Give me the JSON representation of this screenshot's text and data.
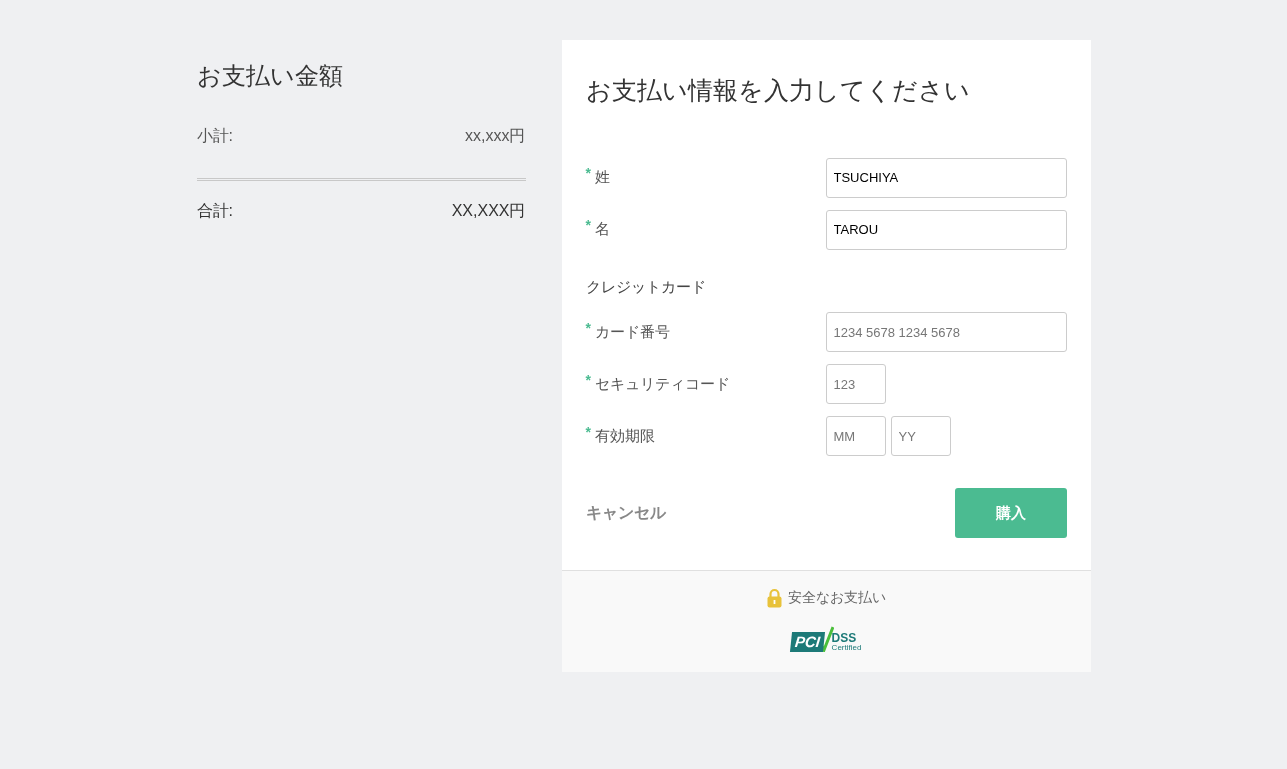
{
  "summary": {
    "title": "お支払い金額",
    "subtotal": {
      "label": "小計:",
      "value": "xx,xxx円"
    },
    "total": {
      "label": "合計:",
      "value": "XX,XXX円"
    }
  },
  "form": {
    "title": "お支払い情報を入力してください",
    "name_fields": [
      {
        "required_mark": "*",
        "label": "姓",
        "inputs": [
          {
            "value": "TSUCHIYA",
            "kind": "wide"
          }
        ]
      },
      {
        "required_mark": "*",
        "label": "名",
        "inputs": [
          {
            "value": "TAROU",
            "kind": "wide"
          }
        ]
      }
    ],
    "card_section": "クレジットカード",
    "card_fields": [
      {
        "required_mark": "*",
        "label": "カード番号",
        "inputs": [
          {
            "placeholder": "1234 5678 1234 5678",
            "kind": "wide"
          }
        ]
      },
      {
        "required_mark": "*",
        "label": "セキュリティコード",
        "inputs": [
          {
            "placeholder": "123",
            "kind": "small"
          }
        ]
      },
      {
        "required_mark": "*",
        "label": "有効期限",
        "inputs": [
          {
            "placeholder": "MM",
            "kind": "small"
          },
          {
            "placeholder": "YY",
            "kind": "small"
          }
        ]
      }
    ],
    "cancel": "キャンセル",
    "submit": "購入"
  },
  "footer": {
    "secure_text": "安全なお支払い",
    "logo": {
      "pci": "PCI",
      "dss": "DSS",
      "certified": "Certified"
    }
  }
}
